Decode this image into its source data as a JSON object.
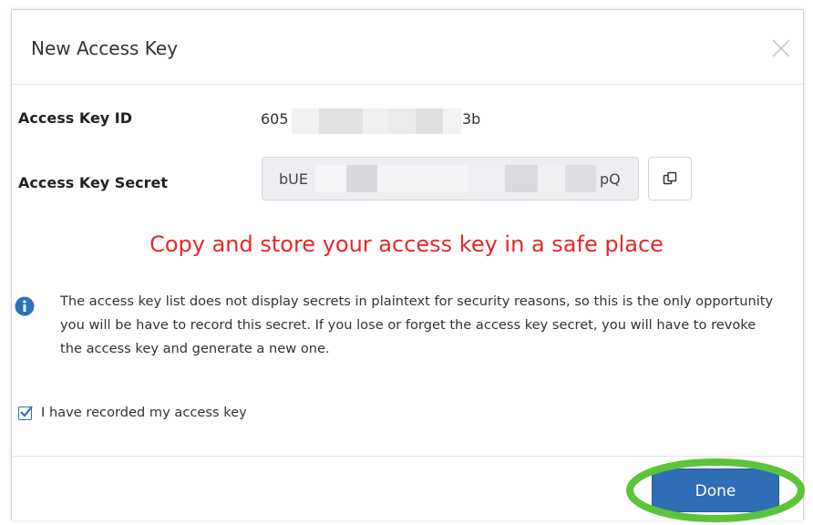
{
  "dialog": {
    "title": "New Access Key",
    "close_icon": "close-icon"
  },
  "access_key_id": {
    "label": "Access Key ID",
    "value_prefix": "605",
    "value_suffix": "3b"
  },
  "access_key_secret": {
    "label": "Access Key Secret",
    "value_prefix": "bUE",
    "value_suffix": "pQ",
    "copy_icon": "copy-icon"
  },
  "warning": {
    "text": "Copy and store your access key in a safe place",
    "color": "#e8262a"
  },
  "info": {
    "icon": "info-icon",
    "text": "The access key list does not display secrets in plaintext for security reasons, so this is the only opportunity you will be have to record this secret. If you lose or forget the access key secret, you will have to revoke the access key and generate a new one."
  },
  "confirm": {
    "label": "I have recorded my access key",
    "checked": true
  },
  "footer": {
    "done_label": "Done",
    "accent_color": "#2f6db5",
    "highlight_color": "#5cc43a"
  }
}
